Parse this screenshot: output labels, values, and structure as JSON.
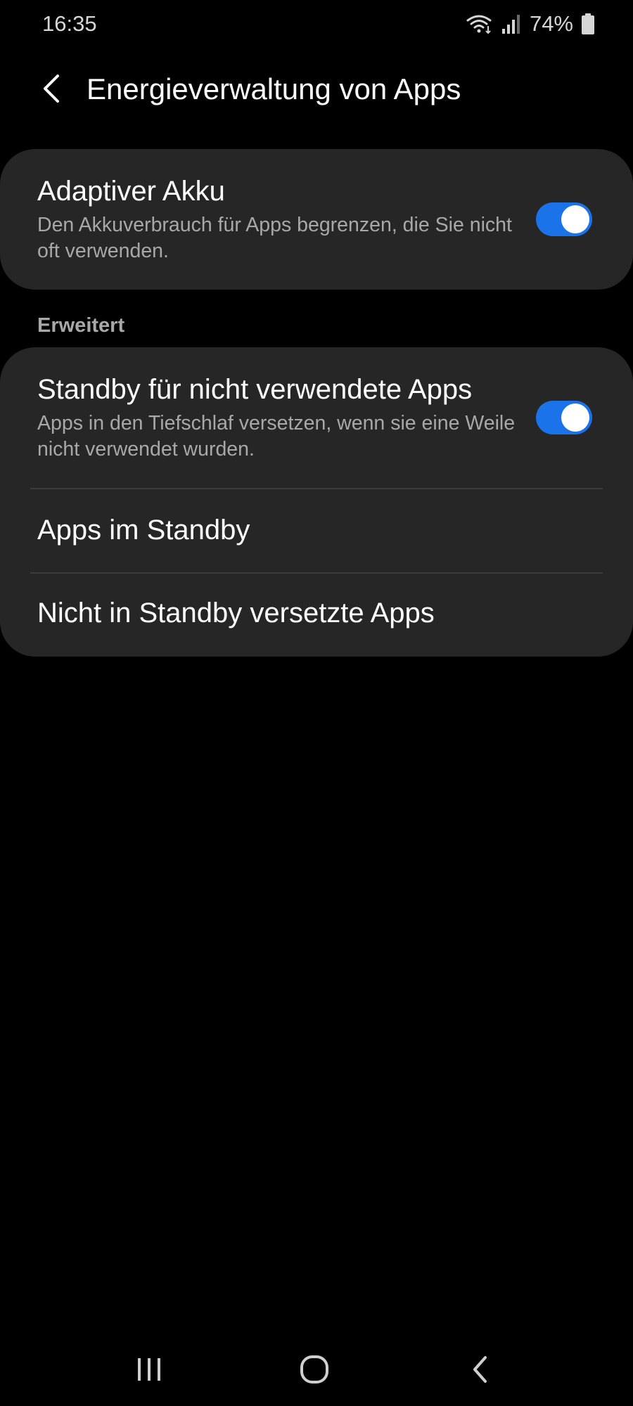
{
  "status_bar": {
    "time": "16:35",
    "battery_percent": "74%",
    "icons": [
      "wifi-icon",
      "signal-icon",
      "battery-icon"
    ]
  },
  "header": {
    "title": "Energieverwaltung von Apps",
    "back_icon": "chevron-left-icon"
  },
  "adaptive_battery": {
    "title": "Adaptiver Akku",
    "description": "Den Akkuverbrauch für Apps begrenzen, die Sie nicht oft verwenden.",
    "enabled": true
  },
  "advanced": {
    "section_label": "Erweitert",
    "standby_unused": {
      "title": "Standby für nicht verwendete Apps",
      "description": "Apps in den Tiefschlaf versetzen, wenn sie eine Weile nicht verwendet wurden.",
      "enabled": true
    },
    "apps_in_standby": {
      "title": "Apps im Standby"
    },
    "apps_not_in_standby": {
      "title": "Nicht in Standby versetzte Apps"
    }
  },
  "nav_bar": {
    "icons": [
      "recent-apps-icon",
      "home-icon",
      "back-icon"
    ]
  },
  "colors": {
    "background": "#000000",
    "card": "#262626",
    "accent": "#1a73e8",
    "secondary_text": "#a8a8a8"
  }
}
